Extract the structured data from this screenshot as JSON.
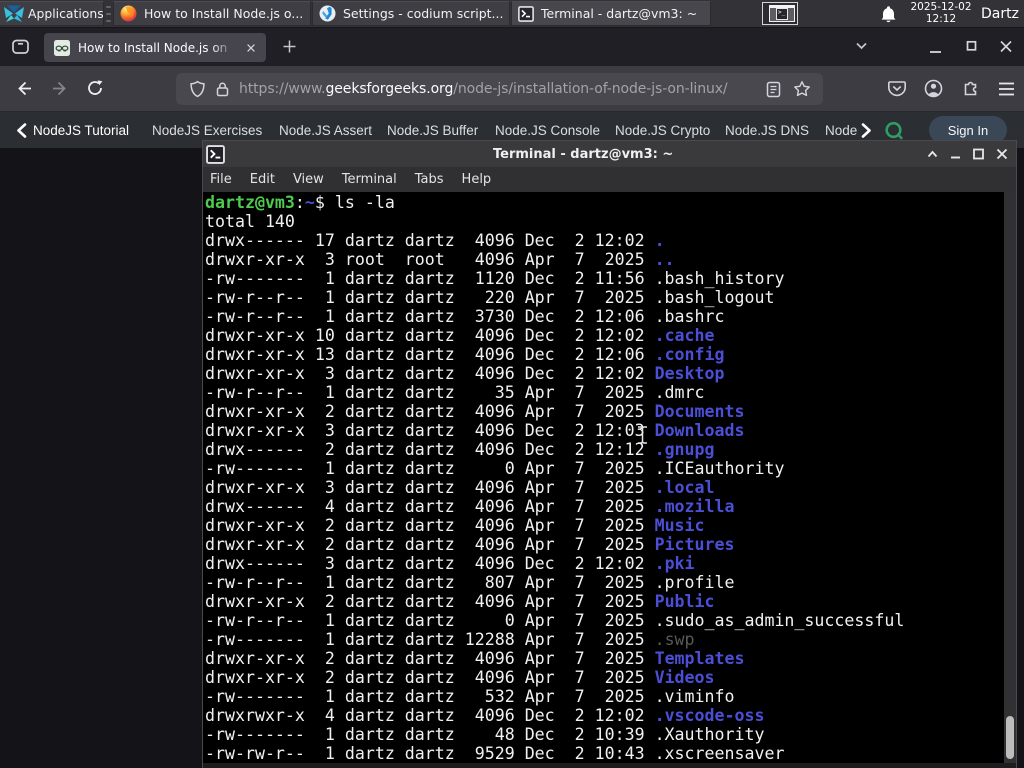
{
  "panel": {
    "applications": {
      "label": "Applications"
    },
    "tasks": [
      {
        "app": "firefox",
        "title": "How to Install Node.js o..."
      },
      {
        "app": "vscodium",
        "title": "Settings - codium script..."
      },
      {
        "app": "terminal",
        "title": "Terminal - dartz@vm3: ~"
      }
    ],
    "clock": {
      "date": "2025-12-02",
      "time": "12:12"
    },
    "user": "Dartz"
  },
  "browser": {
    "tab": {
      "title": "How to Install Node.js on"
    },
    "url": {
      "scheme": "https://www.",
      "domain": "geeksforgeeks.org",
      "path": "/node-js/installation-of-node-js-on-linux/"
    }
  },
  "site_nav": {
    "items": [
      "NodeJS Tutorial",
      "NodeJS Exercises",
      "Node.JS Assert",
      "Node.JS Buffer",
      "Node.JS Console",
      "Node.JS Crypto",
      "Node.JS DNS",
      "Node"
    ],
    "sign_in_label": "Sign In"
  },
  "terminal_window": {
    "title": "Terminal - dartz@vm3: ~",
    "menu": [
      "File",
      "Edit",
      "View",
      "Terminal",
      "Tabs",
      "Help"
    ],
    "lines": [
      [
        {
          "t": "dartz@vm3",
          "c": "g"
        },
        {
          "t": ":",
          "c": "w"
        },
        {
          "t": "~",
          "c": "b"
        },
        {
          "t": "$ ls -la",
          "c": "w"
        }
      ],
      [
        {
          "t": "total 140",
          "c": "w"
        }
      ],
      [
        {
          "t": "drwx------ 17 dartz dartz  4096 Dec  2 12:02 ",
          "c": "w"
        },
        {
          "t": ".",
          "c": "b"
        }
      ],
      [
        {
          "t": "drwxr-xr-x  3 root  root   4096 Apr  7  2025 ",
          "c": "w"
        },
        {
          "t": "..",
          "c": "b"
        }
      ],
      [
        {
          "t": "-rw-------  1 dartz dartz  1120 Dec  2 11:56 .bash_history",
          "c": "w"
        }
      ],
      [
        {
          "t": "-rw-r--r--  1 dartz dartz   220 Apr  7  2025 .bash_logout",
          "c": "w"
        }
      ],
      [
        {
          "t": "-rw-r--r--  1 dartz dartz  3730 Dec  2 12:06 .bashrc",
          "c": "w"
        }
      ],
      [
        {
          "t": "drwxr-xr-x 10 dartz dartz  4096 Dec  2 12:02 ",
          "c": "w"
        },
        {
          "t": ".cache",
          "c": "b"
        }
      ],
      [
        {
          "t": "drwxr-xr-x 13 dartz dartz  4096 Dec  2 12:06 ",
          "c": "w"
        },
        {
          "t": ".config",
          "c": "b"
        }
      ],
      [
        {
          "t": "drwxr-xr-x  3 dartz dartz  4096 Dec  2 12:02 ",
          "c": "w"
        },
        {
          "t": "Desktop",
          "c": "b"
        }
      ],
      [
        {
          "t": "-rw-r--r--  1 dartz dartz    35 Apr  7  2025 .dmrc",
          "c": "w"
        }
      ],
      [
        {
          "t": "drwxr-xr-x  2 dartz dartz  4096 Apr  7  2025 ",
          "c": "w"
        },
        {
          "t": "Documents",
          "c": "b"
        }
      ],
      [
        {
          "t": "drwxr-xr-x  3 dartz dartz  4096 Dec  2 12:03 ",
          "c": "w"
        },
        {
          "t": "Downloads",
          "c": "b"
        }
      ],
      [
        {
          "t": "drwx------  2 dartz dartz  4096 Dec  2 12:12 ",
          "c": "w"
        },
        {
          "t": ".gnupg",
          "c": "b"
        }
      ],
      [
        {
          "t": "-rw-------  1 dartz dartz     0 Apr  7  2025 .ICEauthority",
          "c": "w"
        }
      ],
      [
        {
          "t": "drwxr-xr-x  3 dartz dartz  4096 Apr  7  2025 ",
          "c": "w"
        },
        {
          "t": ".local",
          "c": "b"
        }
      ],
      [
        {
          "t": "drwx------  4 dartz dartz  4096 Apr  7  2025 ",
          "c": "w"
        },
        {
          "t": ".mozilla",
          "c": "b"
        }
      ],
      [
        {
          "t": "drwxr-xr-x  2 dartz dartz  4096 Apr  7  2025 ",
          "c": "w"
        },
        {
          "t": "Music",
          "c": "b"
        }
      ],
      [
        {
          "t": "drwxr-xr-x  2 dartz dartz  4096 Apr  7  2025 ",
          "c": "w"
        },
        {
          "t": "Pictures",
          "c": "b"
        }
      ],
      [
        {
          "t": "drwx------  3 dartz dartz  4096 Dec  2 12:02 ",
          "c": "w"
        },
        {
          "t": ".pki",
          "c": "b"
        }
      ],
      [
        {
          "t": "-rw-r--r--  1 dartz dartz   807 Apr  7  2025 .profile",
          "c": "w"
        }
      ],
      [
        {
          "t": "drwxr-xr-x  2 dartz dartz  4096 Apr  7  2025 ",
          "c": "w"
        },
        {
          "t": "Public",
          "c": "b"
        }
      ],
      [
        {
          "t": "-rw-r--r--  1 dartz dartz     0 Apr  7  2025 .sudo_as_admin_successful",
          "c": "w"
        }
      ],
      [
        {
          "t": "-rw-------  1 dartz dartz 12288 Apr  7  2025 ",
          "c": "w"
        },
        {
          "t": ".swp",
          "c": "x"
        }
      ],
      [
        {
          "t": "drwxr-xr-x  2 dartz dartz  4096 Apr  7  2025 ",
          "c": "w"
        },
        {
          "t": "Templates",
          "c": "b"
        }
      ],
      [
        {
          "t": "drwxr-xr-x  2 dartz dartz  4096 Apr  7  2025 ",
          "c": "w"
        },
        {
          "t": "Videos",
          "c": "b"
        }
      ],
      [
        {
          "t": "-rw-------  1 dartz dartz   532 Apr  7  2025 .viminfo",
          "c": "w"
        }
      ],
      [
        {
          "t": "drwxrwxr-x  4 dartz dartz  4096 Dec  2 12:02 ",
          "c": "w"
        },
        {
          "t": ".vscode-oss",
          "c": "b"
        }
      ],
      [
        {
          "t": "-rw-------  1 dartz dartz    48 Dec  2 10:39 .Xauthority",
          "c": "w"
        }
      ],
      [
        {
          "t": "-rw-rw-r--  1 dartz dartz  9529 Dec  2 10:43 .xscreensaver",
          "c": "w"
        }
      ]
    ]
  },
  "colors": {
    "prompt_green": "#4ecb4e",
    "directory_blue": "#4b4fd6",
    "dim_file_gray": "#595959",
    "gfg_search_green": "#33a060",
    "sign_in_bg": "#3a4757",
    "firefox_toolbar": "#3a3940",
    "terminal_background": "#000000"
  }
}
